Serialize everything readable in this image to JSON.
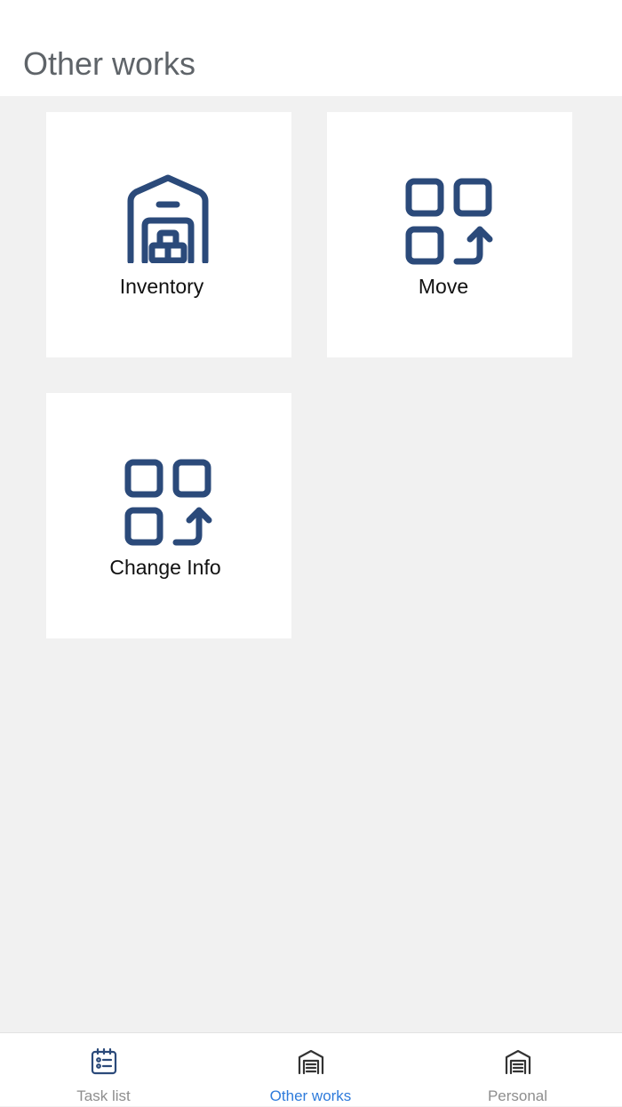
{
  "header": {
    "title": "Other works"
  },
  "tiles": [
    {
      "label": "Inventory",
      "icon": "warehouse-icon"
    },
    {
      "label": "Move",
      "icon": "apps-arrow-up-icon"
    },
    {
      "label": "Change Info",
      "icon": "apps-arrow-up-icon"
    }
  ],
  "tabbar": {
    "tabs": [
      {
        "label": "Task list",
        "icon": "calendar-list-icon",
        "active": false
      },
      {
        "label": "Other works",
        "icon": "warehouse-icon",
        "active": true
      },
      {
        "label": "Personal",
        "icon": "warehouse-icon",
        "active": false
      }
    ]
  },
  "colors": {
    "icon_primary": "#2b4a7a",
    "tab_active": "#2e7bdb",
    "tab_inactive": "#8e8e8e",
    "background": "#f1f1f1",
    "header_text": "#5f6469"
  }
}
